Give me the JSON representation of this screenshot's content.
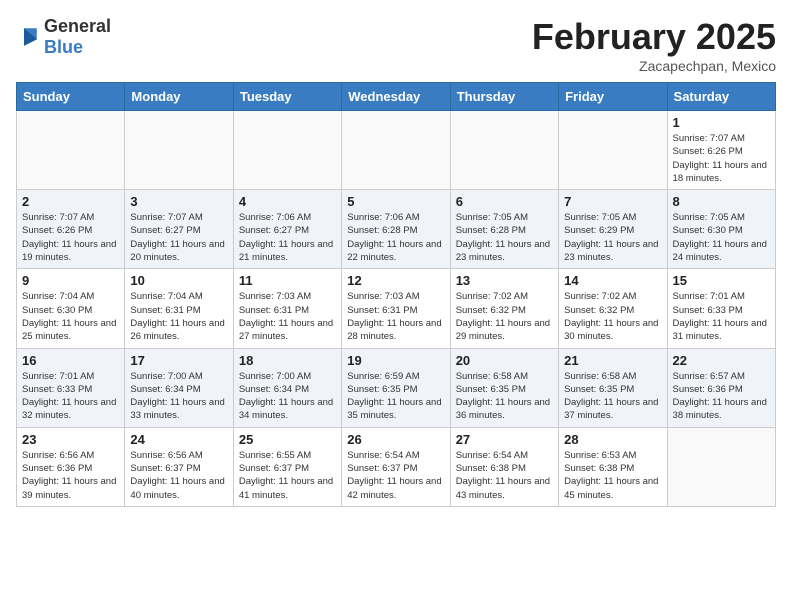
{
  "logo": {
    "text_general": "General",
    "text_blue": "Blue"
  },
  "header": {
    "month_title": "February 2025",
    "location": "Zacapechpan, Mexico"
  },
  "weekdays": [
    "Sunday",
    "Monday",
    "Tuesday",
    "Wednesday",
    "Thursday",
    "Friday",
    "Saturday"
  ],
  "weeks": [
    {
      "shaded": false,
      "days": [
        {
          "num": "",
          "info": ""
        },
        {
          "num": "",
          "info": ""
        },
        {
          "num": "",
          "info": ""
        },
        {
          "num": "",
          "info": ""
        },
        {
          "num": "",
          "info": ""
        },
        {
          "num": "",
          "info": ""
        },
        {
          "num": "1",
          "info": "Sunrise: 7:07 AM\nSunset: 6:26 PM\nDaylight: 11 hours and 18 minutes."
        }
      ]
    },
    {
      "shaded": true,
      "days": [
        {
          "num": "2",
          "info": "Sunrise: 7:07 AM\nSunset: 6:26 PM\nDaylight: 11 hours and 19 minutes."
        },
        {
          "num": "3",
          "info": "Sunrise: 7:07 AM\nSunset: 6:27 PM\nDaylight: 11 hours and 20 minutes."
        },
        {
          "num": "4",
          "info": "Sunrise: 7:06 AM\nSunset: 6:27 PM\nDaylight: 11 hours and 21 minutes."
        },
        {
          "num": "5",
          "info": "Sunrise: 7:06 AM\nSunset: 6:28 PM\nDaylight: 11 hours and 22 minutes."
        },
        {
          "num": "6",
          "info": "Sunrise: 7:05 AM\nSunset: 6:28 PM\nDaylight: 11 hours and 23 minutes."
        },
        {
          "num": "7",
          "info": "Sunrise: 7:05 AM\nSunset: 6:29 PM\nDaylight: 11 hours and 23 minutes."
        },
        {
          "num": "8",
          "info": "Sunrise: 7:05 AM\nSunset: 6:30 PM\nDaylight: 11 hours and 24 minutes."
        }
      ]
    },
    {
      "shaded": false,
      "days": [
        {
          "num": "9",
          "info": "Sunrise: 7:04 AM\nSunset: 6:30 PM\nDaylight: 11 hours and 25 minutes."
        },
        {
          "num": "10",
          "info": "Sunrise: 7:04 AM\nSunset: 6:31 PM\nDaylight: 11 hours and 26 minutes."
        },
        {
          "num": "11",
          "info": "Sunrise: 7:03 AM\nSunset: 6:31 PM\nDaylight: 11 hours and 27 minutes."
        },
        {
          "num": "12",
          "info": "Sunrise: 7:03 AM\nSunset: 6:31 PM\nDaylight: 11 hours and 28 minutes."
        },
        {
          "num": "13",
          "info": "Sunrise: 7:02 AM\nSunset: 6:32 PM\nDaylight: 11 hours and 29 minutes."
        },
        {
          "num": "14",
          "info": "Sunrise: 7:02 AM\nSunset: 6:32 PM\nDaylight: 11 hours and 30 minutes."
        },
        {
          "num": "15",
          "info": "Sunrise: 7:01 AM\nSunset: 6:33 PM\nDaylight: 11 hours and 31 minutes."
        }
      ]
    },
    {
      "shaded": true,
      "days": [
        {
          "num": "16",
          "info": "Sunrise: 7:01 AM\nSunset: 6:33 PM\nDaylight: 11 hours and 32 minutes."
        },
        {
          "num": "17",
          "info": "Sunrise: 7:00 AM\nSunset: 6:34 PM\nDaylight: 11 hours and 33 minutes."
        },
        {
          "num": "18",
          "info": "Sunrise: 7:00 AM\nSunset: 6:34 PM\nDaylight: 11 hours and 34 minutes."
        },
        {
          "num": "19",
          "info": "Sunrise: 6:59 AM\nSunset: 6:35 PM\nDaylight: 11 hours and 35 minutes."
        },
        {
          "num": "20",
          "info": "Sunrise: 6:58 AM\nSunset: 6:35 PM\nDaylight: 11 hours and 36 minutes."
        },
        {
          "num": "21",
          "info": "Sunrise: 6:58 AM\nSunset: 6:35 PM\nDaylight: 11 hours and 37 minutes."
        },
        {
          "num": "22",
          "info": "Sunrise: 6:57 AM\nSunset: 6:36 PM\nDaylight: 11 hours and 38 minutes."
        }
      ]
    },
    {
      "shaded": false,
      "days": [
        {
          "num": "23",
          "info": "Sunrise: 6:56 AM\nSunset: 6:36 PM\nDaylight: 11 hours and 39 minutes."
        },
        {
          "num": "24",
          "info": "Sunrise: 6:56 AM\nSunset: 6:37 PM\nDaylight: 11 hours and 40 minutes."
        },
        {
          "num": "25",
          "info": "Sunrise: 6:55 AM\nSunset: 6:37 PM\nDaylight: 11 hours and 41 minutes."
        },
        {
          "num": "26",
          "info": "Sunrise: 6:54 AM\nSunset: 6:37 PM\nDaylight: 11 hours and 42 minutes."
        },
        {
          "num": "27",
          "info": "Sunrise: 6:54 AM\nSunset: 6:38 PM\nDaylight: 11 hours and 43 minutes."
        },
        {
          "num": "28",
          "info": "Sunrise: 6:53 AM\nSunset: 6:38 PM\nDaylight: 11 hours and 45 minutes."
        },
        {
          "num": "",
          "info": ""
        }
      ]
    }
  ]
}
